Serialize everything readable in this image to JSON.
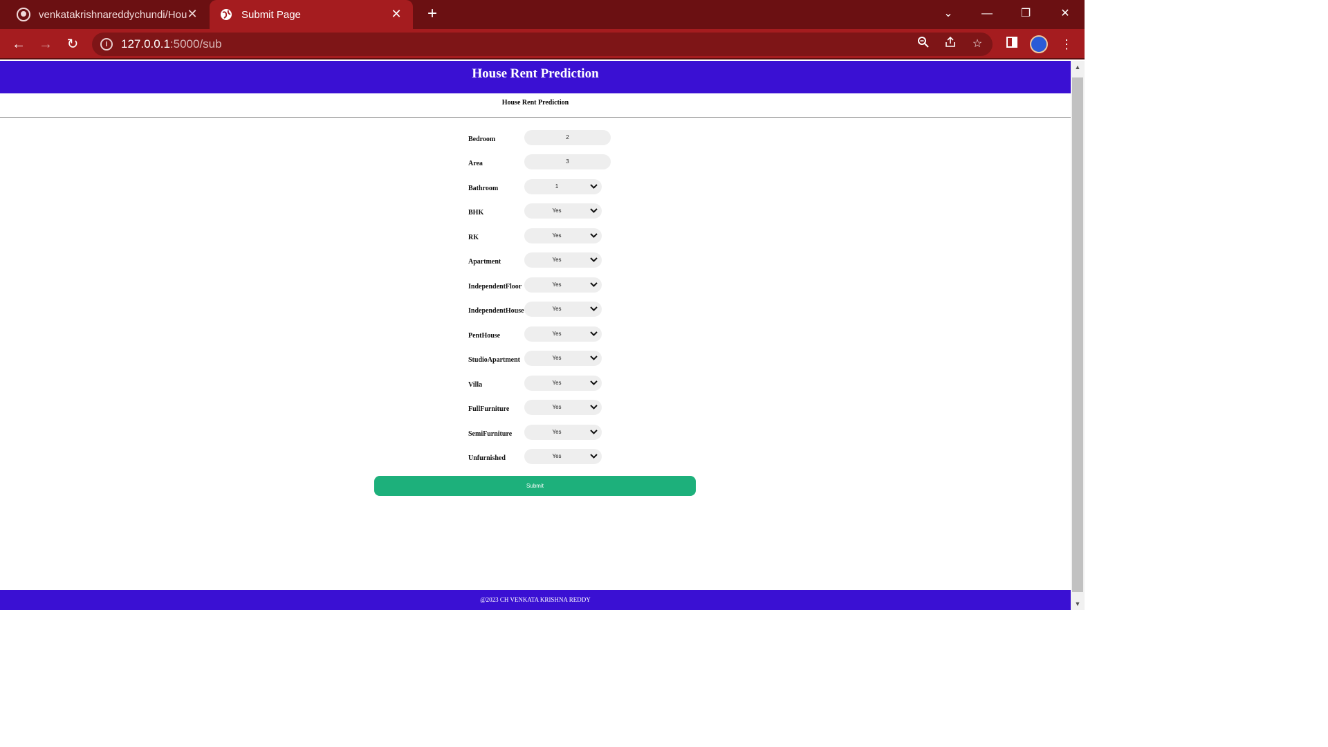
{
  "browser": {
    "tabs": [
      {
        "title": "venkatakrishnareddychundi/Hou",
        "icon": "github-icon"
      },
      {
        "title": "Submit Page",
        "icon": "globe-icon"
      }
    ],
    "url_host": "127.0.0.1",
    "url_path": ":5000/sub",
    "close_glyph": "✕",
    "new_tab_glyph": "+"
  },
  "header": {
    "title": "House Rent Prediction"
  },
  "subtitle": "House Rent Prediction",
  "form": {
    "fields": [
      {
        "label": "Bedroom",
        "type": "input",
        "value": "2"
      },
      {
        "label": "Area",
        "type": "input",
        "value": "3"
      },
      {
        "label": "Bathroom",
        "type": "select",
        "value": "1"
      },
      {
        "label": "BHK",
        "type": "select",
        "value": "Yes"
      },
      {
        "label": "RK",
        "type": "select",
        "value": "Yes"
      },
      {
        "label": "Apartment",
        "type": "select",
        "value": "Yes"
      },
      {
        "label": "IndependentFloor",
        "type": "select",
        "value": "Yes"
      },
      {
        "label": "IndependentHouse",
        "type": "select",
        "value": "Yes"
      },
      {
        "label": "PentHouse",
        "type": "select",
        "value": "Yes"
      },
      {
        "label": "StudioApartment",
        "type": "select",
        "value": "Yes"
      },
      {
        "label": "Villa",
        "type": "select",
        "value": "Yes"
      },
      {
        "label": "FullFurniture",
        "type": "select",
        "value": "Yes"
      },
      {
        "label": "SemiFurniture",
        "type": "select",
        "value": "Yes"
      },
      {
        "label": "Unfurnished",
        "type": "select",
        "value": "Yes"
      }
    ],
    "submit_label": "Submit"
  },
  "footer": {
    "text": "@2023 CH VENKATA KRISHNA REDDY"
  },
  "colors": {
    "header_bg": "#3a10d3",
    "submit_bg": "#1db07b",
    "chrome_tab": "#a51c1f"
  }
}
